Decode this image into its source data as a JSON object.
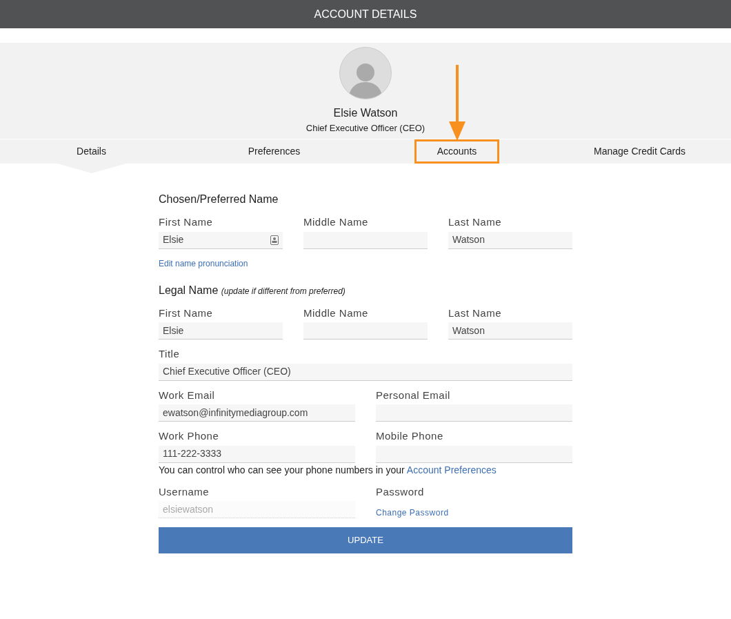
{
  "header": {
    "title": "ACCOUNT DETAILS"
  },
  "profile": {
    "name": "Elsie Watson",
    "role": "Chief Executive Officer (CEO)"
  },
  "tabs": [
    {
      "label": "Details",
      "selected": true,
      "highlighted": false
    },
    {
      "label": "Preferences",
      "selected": false,
      "highlighted": false
    },
    {
      "label": "Accounts",
      "selected": false,
      "highlighted": true
    },
    {
      "label": "Manage Credit Cards",
      "selected": false,
      "highlighted": false
    }
  ],
  "form": [
    {
      "kind": "heading",
      "text": "Chosen/Preferred Name"
    },
    {
      "kind": "fields",
      "fields": [
        {
          "kind": "pronunciation",
          "label": "First Name",
          "value": "Elsie",
          "disabled": false
        },
        {
          "kind": "text",
          "label": "Middle Name",
          "disabled": false
        },
        {
          "kind": "text",
          "label": "Last Name",
          "value": "Watson",
          "disabled": false
        }
      ]
    },
    {
      "kind": "link",
      "text": "Edit name pronunciation"
    },
    {
      "kind": "heading",
      "text": "Legal Name",
      "note": "(update if different from preferred)"
    },
    {
      "kind": "fields",
      "fields": [
        {
          "kind": "text",
          "label": "First Name",
          "value": "Elsie",
          "disabled": false
        },
        {
          "kind": "text",
          "label": "Middle Name",
          "disabled": false
        },
        {
          "kind": "text",
          "label": "Last Name",
          "value": "Watson",
          "disabled": false
        }
      ]
    },
    {
      "kind": "fields",
      "fields": [
        {
          "kind": "text",
          "label": "Title",
          "value": "Chief Executive Officer (CEO)",
          "disabled": false
        }
      ]
    },
    {
      "kind": "fields",
      "fields": [
        {
          "kind": "text",
          "label": "Work Email",
          "value": "ewatson@infinitymediagroup.com",
          "disabled": false
        },
        {
          "kind": "text",
          "label": "Personal Email",
          "disabled": false
        }
      ]
    },
    {
      "kind": "fields",
      "fields": [
        {
          "kind": "text",
          "label": "Work Phone",
          "value": "111-222-3333",
          "disabled": false
        },
        {
          "kind": "text",
          "label": "Mobile Phone",
          "disabled": false
        }
      ]
    },
    {
      "kind": "note",
      "text": "You can control who can see your phone numbers in your ",
      "link": "Account Preferences"
    },
    {
      "kind": "fields",
      "fields": [
        {
          "kind": "text",
          "label": "Username",
          "value": "elsiewatson",
          "disabled": true
        },
        {
          "kind": "link",
          "label": "Password",
          "link": "Change Password"
        }
      ]
    },
    {
      "kind": "button",
      "text": "UPDATE"
    }
  ]
}
